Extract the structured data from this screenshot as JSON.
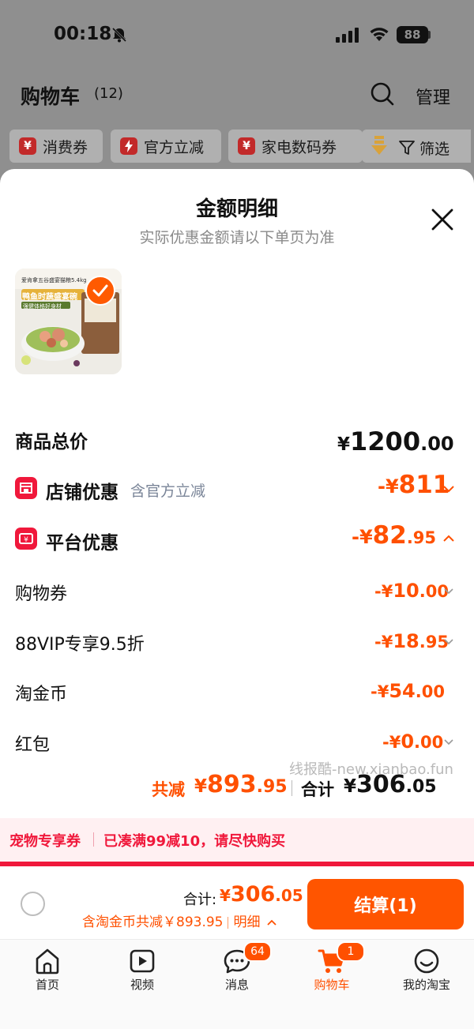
{
  "status_bar": {
    "time": "00:18",
    "battery": "88"
  },
  "cart": {
    "title": "购物车",
    "count": "(12)",
    "manage_label": "管理"
  },
  "filter_chips": [
    {
      "label": "消费券",
      "icon": "coupon-icon"
    },
    {
      "label": "官方立减",
      "icon": "lightning-icon"
    },
    {
      "label": "家电数码券",
      "icon": "coupon-icon"
    }
  ],
  "filter_label": "筛选",
  "sheet": {
    "title": "金额明细",
    "subtitle": "实际优惠金额请以下单页为准",
    "product_image": {
      "headline": "鸭鱼时蔬盛宴碗",
      "subline": "强健体格好身材",
      "top_text": "爱肯拿五谷盛宴猫粮5.4kg"
    },
    "total_label": "商品总价",
    "total_amount": {
      "currency": "¥",
      "integer": "1200",
      "decimal": ".00"
    },
    "store_discount": {
      "label": "店铺优惠",
      "note": "含官方立减",
      "amount": {
        "prefix": "-¥",
        "integer": "811",
        "decimal": ""
      }
    },
    "platform_discount": {
      "label": "平台优惠",
      "amount": {
        "prefix": "-¥",
        "integer": "82",
        "decimal": ".95"
      }
    },
    "platform_items": [
      {
        "label": "购物券",
        "prefix": "-¥",
        "integer": "10",
        "decimal": ".00"
      },
      {
        "label": "88VIP专享9.5折",
        "prefix": "-¥",
        "integer": "18",
        "decimal": ".95"
      },
      {
        "label": "淘金币",
        "prefix": "-¥",
        "integer": "54",
        "decimal": ".00"
      },
      {
        "label": "红包",
        "prefix": "-¥",
        "integer": "0",
        "decimal": ".00"
      }
    ],
    "summary": {
      "reduce_label": "共减",
      "reduce_currency": "¥",
      "reduce_integer": "893",
      "reduce_decimal": ".95",
      "sum_label": "合计",
      "sum_currency": "¥",
      "sum_integer": "306",
      "sum_decimal": ".05"
    },
    "watermark": "线报酷-new.xianbao.fun",
    "promo": {
      "tag": "宠物专享券",
      "text": "已凑满99减10，请尽快购买"
    }
  },
  "checkout": {
    "sum_label": "合计:",
    "currency": "¥",
    "integer": "306",
    "decimal": ".05",
    "detail_text": "含淘金币共减￥893.95",
    "detail_link": "明细",
    "button_label": "结算(1)"
  },
  "tabs": [
    {
      "label": "首页",
      "icon": "home-icon"
    },
    {
      "label": "视频",
      "icon": "video-icon"
    },
    {
      "label": "消息",
      "icon": "message-icon",
      "badge": "64"
    },
    {
      "label": "购物车",
      "icon": "cart-icon",
      "badge": "1",
      "active": true
    },
    {
      "label": "我的淘宝",
      "icon": "profile-icon"
    }
  ],
  "colors": {
    "accent": "#ff5000",
    "platform_red": "#f0183b",
    "overlay_gray": "#8f8f8f"
  }
}
